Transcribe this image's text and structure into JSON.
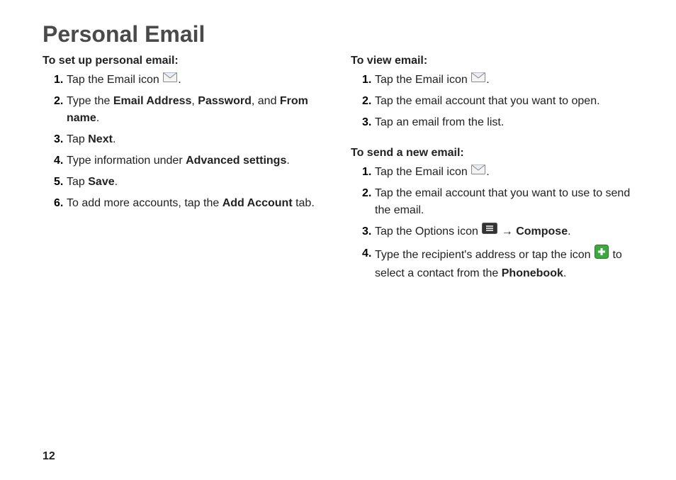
{
  "title": "Personal Email",
  "pageNumber": "12",
  "left": {
    "heading": "To set up personal email:",
    "steps": {
      "s1_prefix": "Tap the Email icon ",
      "s1_suffix": ".",
      "s2_1": "Type the ",
      "s2_b1": "Email Address",
      "s2_2": ", ",
      "s2_b2": "Password",
      "s2_3": ", and ",
      "s2_b3": "From name",
      "s2_4": ".",
      "s3_1": "Tap ",
      "s3_b1": "Next",
      "s3_2": ".",
      "s4_1": "Type information under ",
      "s4_b1": "Advanced settings",
      "s4_2": ".",
      "s5_1": "Tap ",
      "s5_b1": "Save",
      "s5_2": ".",
      "s6_1": "To add more accounts, tap the ",
      "s6_b1": "Add Account",
      "s6_2": " tab."
    }
  },
  "rightView": {
    "heading": "To view email:",
    "steps": {
      "s1_prefix": "Tap the Email icon ",
      "s1_suffix": ".",
      "s2": "Tap the email account that you want to open.",
      "s3": "Tap an email from the list."
    }
  },
  "rightSend": {
    "heading": "To send a new email:",
    "steps": {
      "s1_prefix": "Tap the Email icon ",
      "s1_suffix": ".",
      "s2": "Tap the email account that you want to use to send the email.",
      "s3_1": "Tap the Options icon ",
      "s3_arrow": " → ",
      "s3_b1": "Compose",
      "s3_2": ".",
      "s4_1": "Type the recipient's address or tap the icon ",
      "s4_2": " to select a contact from the ",
      "s4_b1": "Phonebook",
      "s4_3": "."
    }
  }
}
